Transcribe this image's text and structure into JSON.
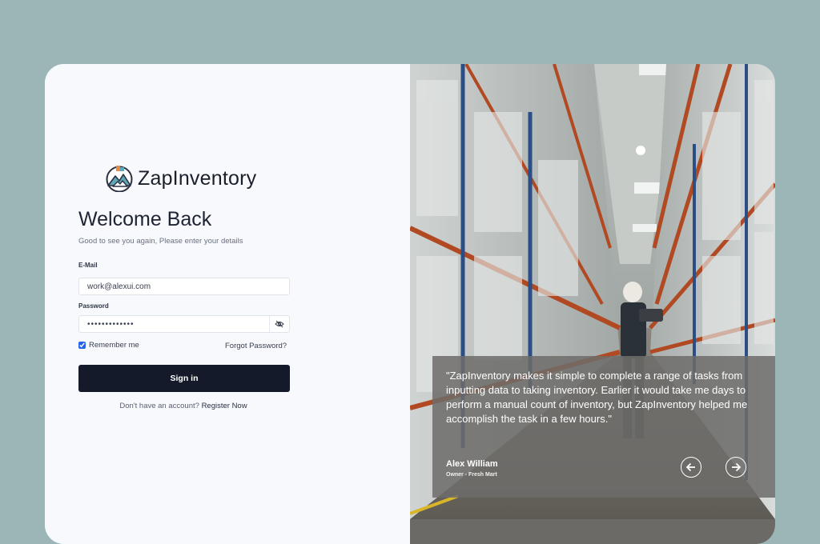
{
  "brand": {
    "name": "ZapInventory"
  },
  "login": {
    "title": "Welcome Back",
    "subtitle": "Good to see you again, Please enter your details",
    "email_label": "E-Mail",
    "email_value": "work@alexui.com",
    "password_label": "Password",
    "password_value": "•••••••••••••",
    "remember_label": "Remember me",
    "remember_checked": true,
    "forgot_label": "Forgot Password?",
    "signin_label": "Sign in",
    "no_account_text": "Don't have an account?",
    "register_label": "Register Now"
  },
  "testimonial": {
    "quote": "\"ZapInventory makes it simple to complete a range of tasks from inputting data to taking inventory. Earlier it would take me days to perform a manual count of inventory, but ZapInventory helped me accomplish the task in a few hours.\"",
    "author": "Alex William",
    "role": "Owner - Fresh Mart",
    "prev_icon": "arrow-left-circle-icon",
    "next_icon": "arrow-right-circle-icon"
  },
  "colors": {
    "background": "#9cb6b7",
    "panel": "#f7f9fd",
    "button": "#141a2a",
    "checkbox": "#2563eb"
  }
}
